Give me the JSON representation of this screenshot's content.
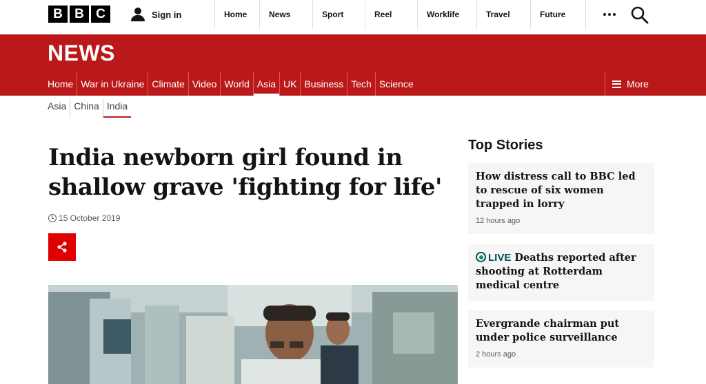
{
  "brand": {
    "letters": [
      "B",
      "B",
      "C"
    ]
  },
  "topbar": {
    "signin_label": "Sign in",
    "nav": [
      "Home",
      "News",
      "Sport",
      "Reel",
      "Worklife",
      "Travel",
      "Future"
    ]
  },
  "news": {
    "title": "NEWS"
  },
  "section_nav": {
    "items": [
      "Home",
      "War in Ukraine",
      "Climate",
      "Video",
      "World",
      "Asia",
      "UK",
      "Business",
      "Tech",
      "Science"
    ],
    "active": "Asia",
    "more_label": "More"
  },
  "sub_nav": {
    "items": [
      "Asia",
      "China",
      "India"
    ],
    "active": "India"
  },
  "article": {
    "headline": "India newborn girl found in shallow grave 'fighting for life'",
    "date": "15 October 2019"
  },
  "top_stories": {
    "title": "Top Stories",
    "stories": [
      {
        "headline": "How distress call to BBC led to rescue of six women trapped in lorry",
        "time": "12 hours ago"
      },
      {
        "live_label": "LIVE",
        "headline": "Deaths reported after shooting at Rotterdam medical centre"
      },
      {
        "headline": "Evergrande chairman put under police surveillance",
        "time": "2 hours ago"
      }
    ]
  },
  "colors": {
    "brand_red": "#bb1919",
    "share_red": "#e10000",
    "live_teal": "#004f59",
    "story_bg": "#f6f6f6"
  }
}
